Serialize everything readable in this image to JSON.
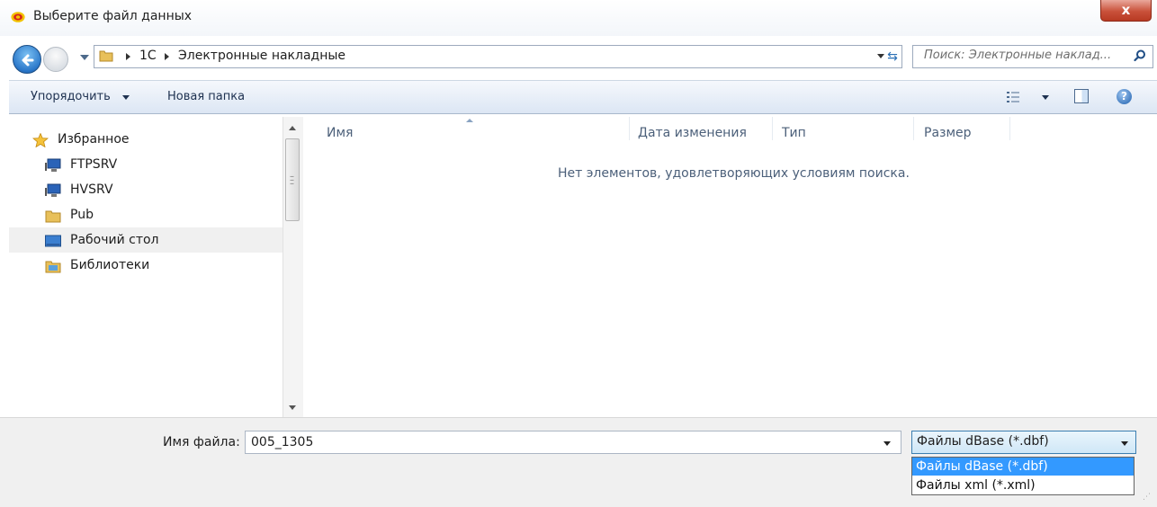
{
  "window": {
    "title": "Выберите файл данных",
    "close_label": "x"
  },
  "address": {
    "crumbs": [
      "1С",
      "Электронные накладные"
    ],
    "search_placeholder": "Поиск: Электронные наклад..."
  },
  "toolbar": {
    "organize_label": "Упорядочить",
    "new_folder_label": "Новая папка"
  },
  "nav": {
    "items": [
      {
        "label": "Избранное",
        "icon": "star-icon"
      },
      {
        "label": "FTPSRV",
        "icon": "network-computer-icon"
      },
      {
        "label": "HVSRV",
        "icon": "network-computer-icon"
      },
      {
        "label": "Pub",
        "icon": "folder-icon"
      },
      {
        "label": "Рабочий стол",
        "icon": "desktop-icon"
      },
      {
        "label": "Библиотеки",
        "icon": "libraries-icon"
      }
    ],
    "selected_index": 4
  },
  "file_list": {
    "columns": [
      "Имя",
      "Дата изменения",
      "Тип",
      "Размер"
    ],
    "empty_message": "Нет элементов, удовлетворяющих условиям поиска."
  },
  "footer": {
    "filename_label": "Имя файла:",
    "filename_value": "005_1305",
    "filetype_selected": "Файлы dBase (*.dbf)",
    "filetype_options": [
      "Файлы dBase (*.dbf)",
      "Файлы xml (*.xml)"
    ]
  },
  "colors": {
    "selection": "#3399ff",
    "toolbar_top": "#f5f8fc",
    "toolbar_bottom": "#dce6f4",
    "close_button": "#c9513a"
  }
}
